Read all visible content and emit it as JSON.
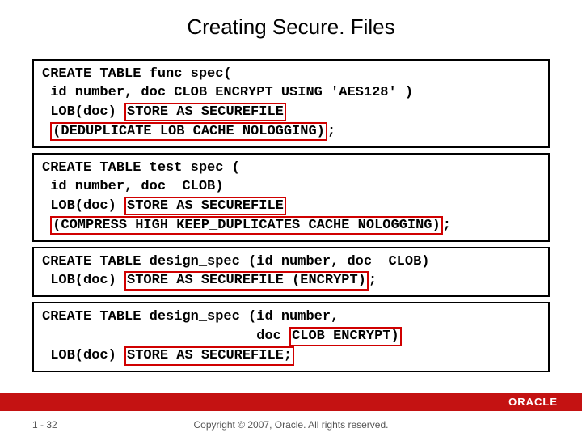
{
  "title": "Creating Secure. Files",
  "boxes": [
    {
      "line1_pre": "CREATE TABLE func_spec(\n id number, doc CLOB ENCRYPT USING 'AES128' )\n LOB(doc) ",
      "hl1": "STORE AS SECUREFILE",
      "line3_post": "\n ",
      "hl2": "(DEDUPLICATE LOB CACHE NOLOGGING)",
      "tail": ";"
    },
    {
      "line1": "CREATE TABLE test_spec (\n id number, doc  CLOB)\n LOB(doc) ",
      "hl1": "STORE AS SECUREFILE",
      "mid": "\n ",
      "hl2": "(COMPRESS HIGH KEEP_DUPLICATES CACHE NOLOGGING)",
      "tail": ";"
    },
    {
      "line1": "CREATE TABLE design_spec (id number, doc  CLOB)\n LOB(doc) ",
      "hl1": "STORE AS SECUREFILE (ENCRYPT)",
      "tail": ";"
    },
    {
      "line1": "CREATE TABLE design_spec (id number,\n                          doc ",
      "hl1": "CLOB ENCRYPT)",
      "mid": "\n LOB(doc) ",
      "hl2": "STORE AS SECUREFILE;",
      "tail": ""
    }
  ],
  "footer": {
    "page": "1 - 32",
    "copyright": "Copyright © 2007, Oracle. All rights reserved.",
    "logo": "ORACLE"
  }
}
